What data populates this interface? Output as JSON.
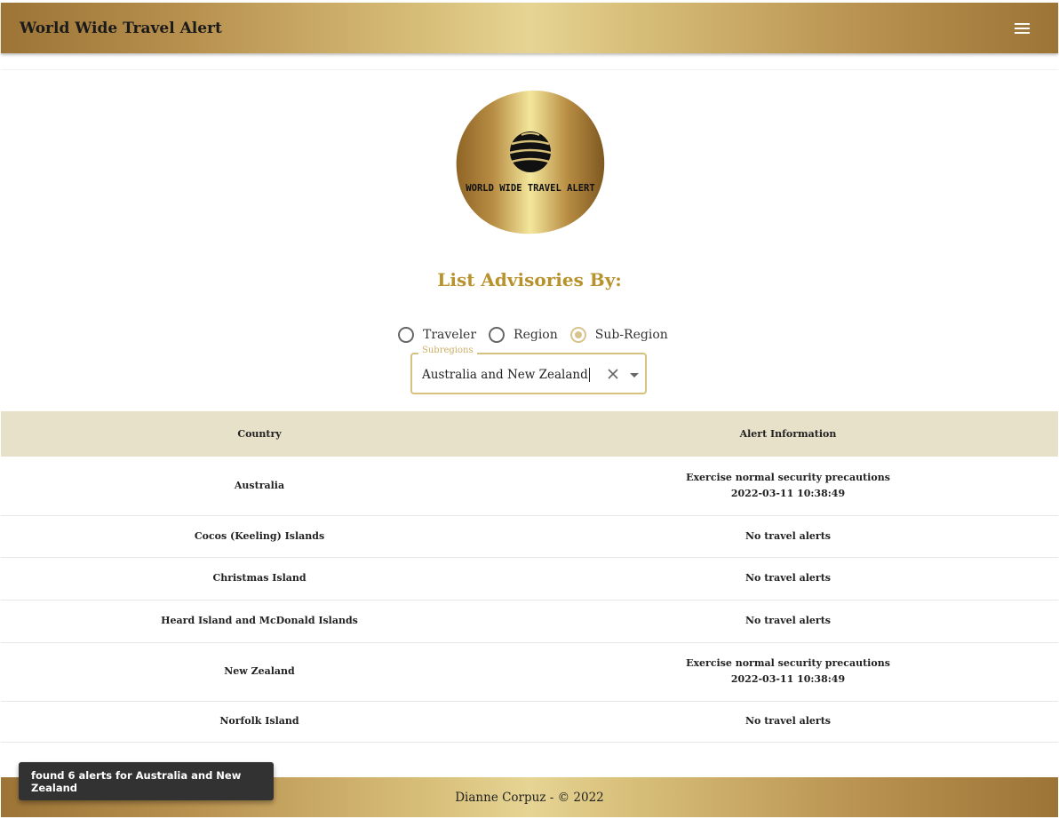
{
  "header": {
    "title": "World Wide Travel Alert",
    "menu_icon": "menu-icon"
  },
  "logo": {
    "text": "WORLD WIDE TRAVEL ALERT",
    "icon": "globe-icon"
  },
  "filter": {
    "heading": "List Advisories By:",
    "options": [
      {
        "label": "Traveler",
        "checked": false
      },
      {
        "label": "Region",
        "checked": false
      },
      {
        "label": "Sub-Region",
        "checked": true
      }
    ],
    "select": {
      "legend": "Subregions",
      "value": "Australia and New Zealand"
    }
  },
  "table": {
    "headers": [
      "Country",
      "Alert Information"
    ],
    "rows": [
      {
        "country": "Australia",
        "alert": "Exercise normal security precautions",
        "date": "2022-03-11 10:38:49"
      },
      {
        "country": "Cocos (Keeling) Islands",
        "alert": "No travel alerts",
        "date": ""
      },
      {
        "country": "Christmas Island",
        "alert": "No travel alerts",
        "date": ""
      },
      {
        "country": "Heard Island and McDonald Islands",
        "alert": "No travel alerts",
        "date": ""
      },
      {
        "country": "New Zealand",
        "alert": "Exercise normal security precautions",
        "date": "2022-03-11 10:38:49"
      },
      {
        "country": "Norfolk Island",
        "alert": "No travel alerts",
        "date": ""
      }
    ]
  },
  "footer": {
    "text": "Dianne Corpuz - © 2022"
  },
  "snackbar": {
    "message": "found 6 alerts for Australia and New Zealand"
  },
  "colors": {
    "accent": "#b8922c",
    "gold_light": "#e6d494",
    "table_header_bg": "#e8e1c9"
  }
}
